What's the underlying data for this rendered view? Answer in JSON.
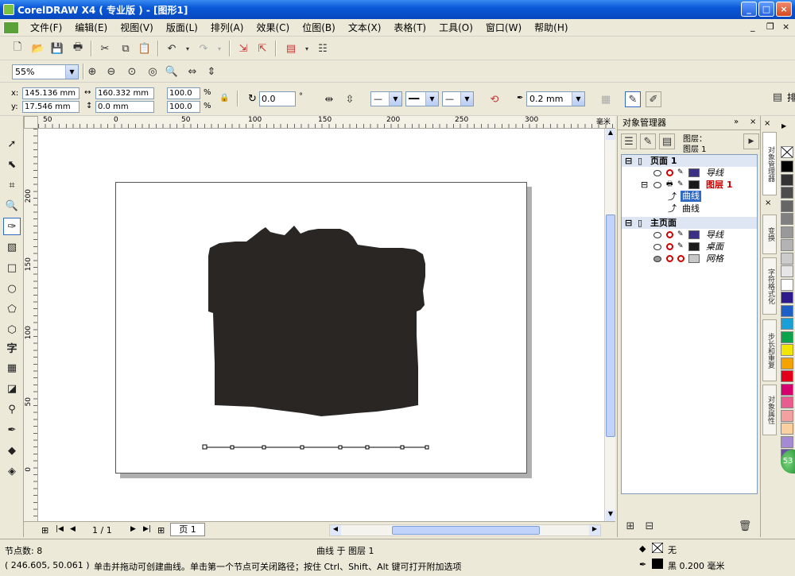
{
  "window": {
    "title": "CorelDRAW X4 ( 专业版 ) - [图形1]",
    "minimize": "_",
    "maximize": "□",
    "close": "×"
  },
  "menu": [
    "文件(F)",
    "编辑(E)",
    "视图(V)",
    "版面(L)",
    "排列(A)",
    "效果(C)",
    "位图(B)",
    "文本(X)",
    "表格(T)",
    "工具(O)",
    "窗口(W)",
    "帮助(H)"
  ],
  "mdi_controls": {
    "minimize": "_",
    "restore": "❐",
    "close": "×"
  },
  "zoom": {
    "value": "55%"
  },
  "props": {
    "x_label": "x:",
    "x_value": "145.136 mm",
    "y_label": "y:",
    "y_value": "17.546 mm",
    "w_value": "160.332 mm",
    "h_value": "0.0 mm",
    "scale_x": "100.0",
    "scale_y": "100.0",
    "percent": "%",
    "rotate": "0.0",
    "degree": "°",
    "outline_width": "0.2 mm",
    "right_label": "排"
  },
  "ruler": {
    "h_ticks": [
      "50",
      "0",
      "50",
      "100",
      "150",
      "200",
      "250",
      "300"
    ],
    "h_unit": "毫米",
    "v_ticks": [
      "200",
      "150",
      "100",
      "50",
      "0"
    ]
  },
  "docker": {
    "title": "对象管理器",
    "layer_info_1": "图层：",
    "layer_info_2": "图层 1",
    "rows": [
      {
        "text": "页面 1",
        "type": "header"
      },
      {
        "text": "导线",
        "type": "layer",
        "color": "#3b2f86"
      },
      {
        "text": "图层 1",
        "type": "layer-active",
        "color": "#1a1a1a"
      },
      {
        "text": "曲线",
        "type": "object-selected"
      },
      {
        "text": "曲线",
        "type": "object"
      },
      {
        "text": "主页面",
        "type": "header"
      },
      {
        "text": "导线",
        "type": "layer",
        "color": "#3b2f86"
      },
      {
        "text": "桌面",
        "type": "layer",
        "color": "#1a1a1a"
      },
      {
        "text": "网格",
        "type": "layer",
        "color": "#c8c8c8"
      }
    ]
  },
  "vertical_tabs": [
    "对象管理器",
    "变换",
    "字符格式化",
    "步长和重复",
    "对象属性"
  ],
  "palette": [
    "#000000",
    "#333333",
    "#4d4d4d",
    "#666666",
    "#808080",
    "#999999",
    "#b3b3b3",
    "#cccccc",
    "#e6e6e6",
    "#ffffff",
    "#2e1a8c",
    "#1e5fc6",
    "#1a9fd6",
    "#0aa34a",
    "#f2e600",
    "#f5a300",
    "#e3001b",
    "#d6006e",
    "#ea5b8f",
    "#f2a0a0",
    "#fbd0a0",
    "#a48ad2",
    "#6c4ca6"
  ],
  "page_nav": {
    "counter": "1 / 1",
    "tab": "页 1"
  },
  "status": {
    "nodes": "节点数: 8",
    "object": "曲线 于 图层 1",
    "coords": "( 246.605, 50.061 )",
    "hint": "单击并拖动可创建曲线。单击第一个节点可关闭路径；按住 Ctrl、Shift、Alt 键可打开附加选项",
    "fill_label": "无",
    "outline_label": "黑  0.200 毫米"
  },
  "colors": {
    "shape": "#2a2623",
    "selection": "#316ac5"
  }
}
